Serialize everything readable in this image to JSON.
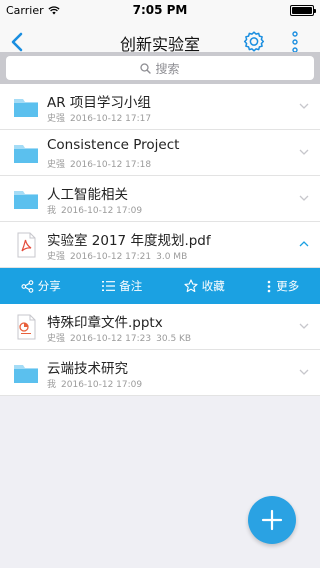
{
  "status_bar": {
    "carrier": "Carrier",
    "time": "7:05 PM"
  },
  "nav": {
    "title": "创新实验室"
  },
  "search": {
    "placeholder": "搜索"
  },
  "files": [
    {
      "name": "AR 项目学习小组",
      "owner": "史强",
      "date": "2016-10-12 17:17",
      "size": "",
      "type": "folder"
    },
    {
      "name": "Consistence Project",
      "owner": "史强",
      "date": "2016-10-12 17:18",
      "size": "",
      "type": "folder"
    },
    {
      "name": "人工智能相关",
      "owner": "我",
      "date": "2016-10-12 17:09",
      "size": "",
      "type": "folder"
    },
    {
      "name": "实验室 2017 年度规划.pdf",
      "owner": "史强",
      "date": "2016-10-12 17:21",
      "size": "3.0 MB",
      "type": "pdf"
    },
    {
      "name": "特殊印章文件.pptx",
      "owner": "史强",
      "date": "2016-10-12 17:23",
      "size": "30.5 KB",
      "type": "pptx"
    },
    {
      "name": "云端技术研究",
      "owner": "我",
      "date": "2016-10-12 17:09",
      "size": "",
      "type": "folder"
    }
  ],
  "actions": {
    "share": "分享",
    "note": "备注",
    "favorite": "收藏",
    "more": "更多"
  },
  "colors": {
    "accent": "#1ba1e2",
    "folder": "#5bc0ee",
    "pdf": "#e44b3c",
    "pptx": "#e8603c"
  }
}
